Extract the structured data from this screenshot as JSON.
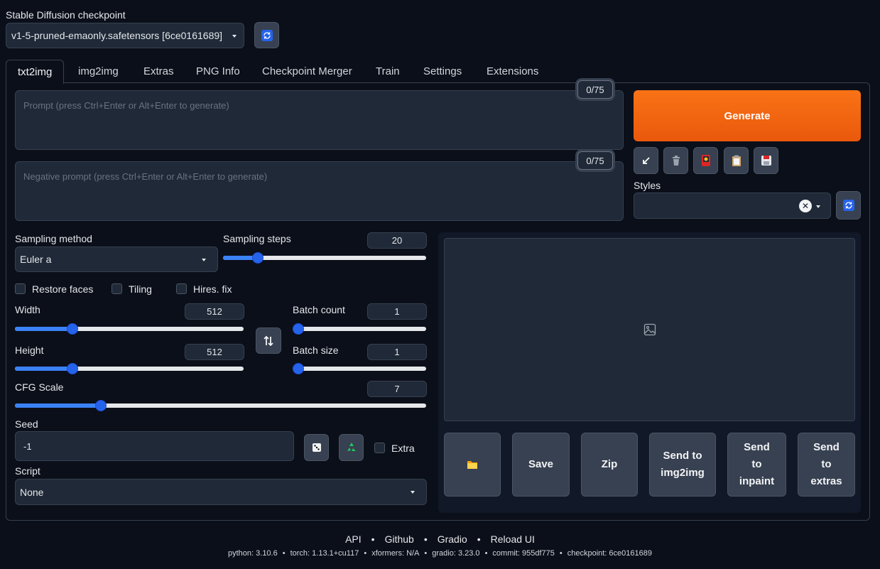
{
  "checkpoint": {
    "label": "Stable Diffusion checkpoint",
    "value": "v1-5-pruned-emaonly.safetensors [6ce0161689]"
  },
  "tabs": [
    "txt2img",
    "img2img",
    "Extras",
    "PNG Info",
    "Checkpoint Merger",
    "Train",
    "Settings",
    "Extensions"
  ],
  "active_tab": "txt2img",
  "prompt": {
    "placeholder": "Prompt (press Ctrl+Enter or Alt+Enter to generate)",
    "counter": "0/75"
  },
  "negative_prompt": {
    "placeholder": "Negative prompt (press Ctrl+Enter or Alt+Enter to generate)",
    "counter": "0/75"
  },
  "generate_label": "Generate",
  "tool_icons": [
    "arrow-icon",
    "trash-icon",
    "red-card-icon",
    "clipboard-icon",
    "save-disk-icon"
  ],
  "styles": {
    "label": "Styles",
    "value": ""
  },
  "sampling": {
    "method_label": "Sampling method",
    "method_value": "Euler a",
    "steps_label": "Sampling steps",
    "steps_value": "20",
    "steps_fraction": 0.15
  },
  "checkboxes": {
    "restore_faces": "Restore faces",
    "tiling": "Tiling",
    "hires_fix": "Hires. fix",
    "extra": "Extra"
  },
  "width": {
    "label": "Width",
    "value": "512",
    "fraction": 0.24
  },
  "height": {
    "label": "Height",
    "value": "512",
    "fraction": 0.24
  },
  "batch_count": {
    "label": "Batch count",
    "value": "1",
    "fraction": 0.0
  },
  "batch_size": {
    "label": "Batch size",
    "value": "1",
    "fraction": 0.0
  },
  "cfg_scale": {
    "label": "CFG Scale",
    "value": "7",
    "fraction": 0.2
  },
  "seed": {
    "label": "Seed",
    "value": "-1"
  },
  "script": {
    "label": "Script",
    "value": "None"
  },
  "output_buttons": {
    "folder_icon": "folder-icon",
    "save": "Save",
    "zip": "Zip",
    "send_img2img": "Send to img2img",
    "send_inpaint": "Send to inpaint",
    "send_extras": "Send to extras"
  },
  "footer": {
    "links": [
      "API",
      "Github",
      "Gradio",
      "Reload UI"
    ],
    "meta": [
      "python: 3.10.6",
      "torch: 1.13.1+cu117",
      "xformers: N/A",
      "gradio: 3.23.0",
      "commit: 955df775",
      "checkpoint: 6ce0161689"
    ]
  },
  "colors": {
    "background": "#0b0f19",
    "generate": "#f97316",
    "accent": "#2563eb"
  }
}
